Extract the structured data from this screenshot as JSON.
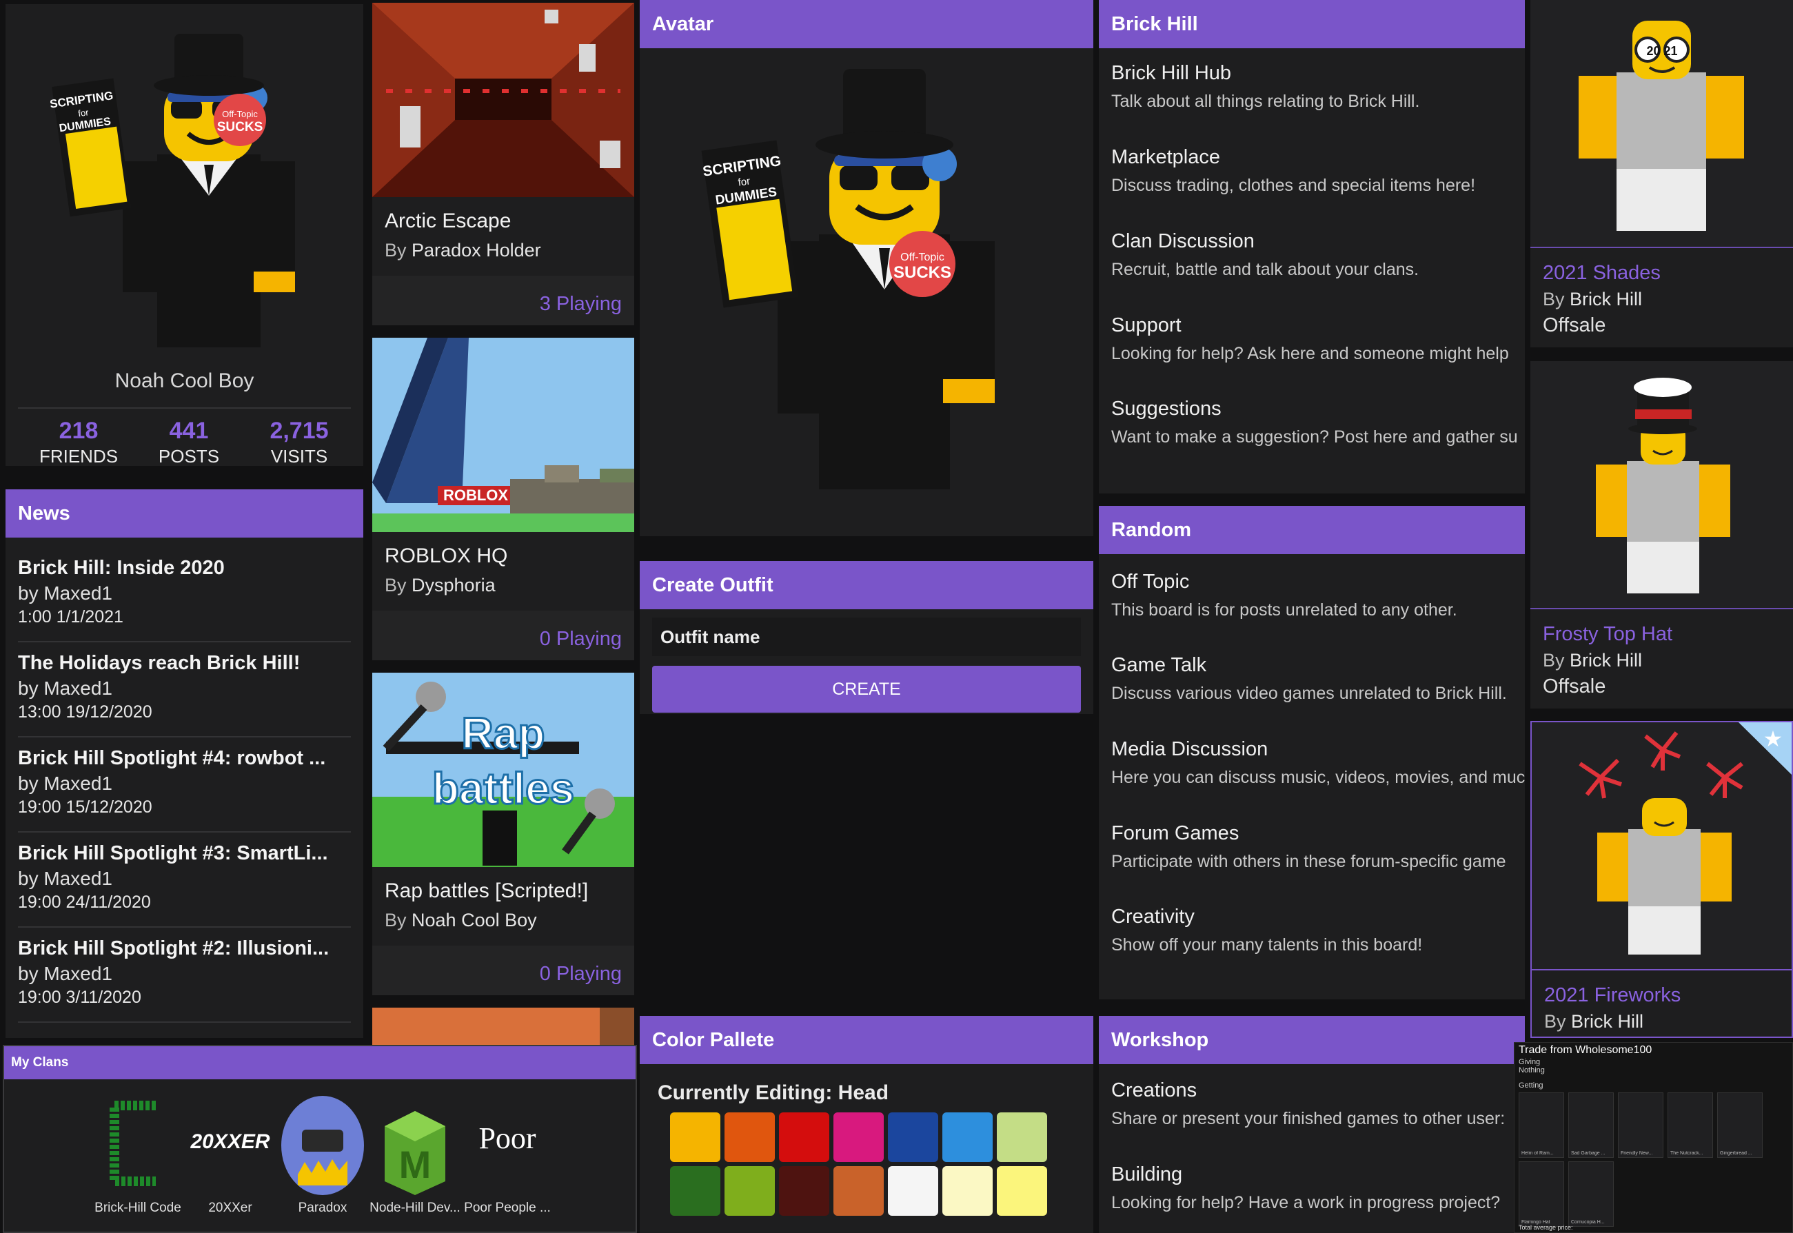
{
  "profile": {
    "username": "Noah Cool Boy",
    "stats": [
      {
        "value": "218",
        "label": "FRIENDS"
      },
      {
        "value": "441",
        "label": "POSTS"
      },
      {
        "value": "2,715",
        "label": "VISITS"
      }
    ]
  },
  "avatar_art": {
    "book_line1": "SCRIPTING",
    "book_line2": "for",
    "book_line3": "DUMMIES",
    "badge_line1": "Off-Topic",
    "badge_line2": "SUCKS"
  },
  "news": {
    "title": "News",
    "items": [
      {
        "title": "Brick Hill: Inside 2020",
        "author": "by Maxed1",
        "date": "1:00 1/1/2021"
      },
      {
        "title": "The Holidays reach Brick Hill!",
        "author": "by Maxed1",
        "date": "13:00 19/12/2020"
      },
      {
        "title": "Brick Hill Spotlight #4: rowbot ...",
        "author": "by Maxed1",
        "date": "19:00 15/12/2020"
      },
      {
        "title": "Brick Hill Spotlight #3: SmartLi...",
        "author": "by Maxed1",
        "date": "19:00 24/11/2020"
      },
      {
        "title": "Brick Hill Spotlight #2: Illusioni...",
        "author": "by Maxed1",
        "date": "19:00 3/11/2020"
      }
    ]
  },
  "games": [
    {
      "title": "Arctic Escape",
      "by": "By",
      "creator": "Paradox Holder",
      "playing": "3 Playing"
    },
    {
      "title": "ROBLOX HQ",
      "by": "By",
      "creator": "Dysphoria",
      "playing": "0 Playing",
      "thumb_text": "ROBLOX"
    },
    {
      "title": "Rap battles [Scripted!]",
      "by": "By",
      "creator": "Noah Cool Boy",
      "playing": "0 Playing",
      "thumb_text1": "Rap",
      "thumb_text2": "battles"
    }
  ],
  "avatar_panel": {
    "title": "Avatar"
  },
  "create_outfit": {
    "title": "Create Outfit",
    "input_placeholder": "Outfit name",
    "button": "CREATE"
  },
  "color_pallete": {
    "title": "Color Pallete",
    "editing": "Currently Editing: Head",
    "colors": [
      "#f5b400",
      "#e0560e",
      "#d40d0d",
      "#d8197e",
      "#1b469e",
      "#2d8fdd",
      "#c4dd86",
      "#2a6e1f",
      "#7fae1c",
      "#4e1310",
      "#c9622a",
      "#f5f5f5",
      "#fbf8c4",
      "#fbf57c"
    ]
  },
  "forums": [
    {
      "title": "Brick Hill",
      "boards": [
        {
          "name": "Brick Hill Hub",
          "desc": "Talk about all things relating to Brick Hill."
        },
        {
          "name": "Marketplace",
          "desc": "Discuss trading, clothes and special items here!"
        },
        {
          "name": "Clan Discussion",
          "desc": "Recruit, battle and talk about your clans."
        },
        {
          "name": "Support",
          "desc": "Looking for help? Ask here and someone might help"
        },
        {
          "name": "Suggestions",
          "desc": "Want to make a suggestion? Post here and gather su"
        }
      ]
    },
    {
      "title": "Random",
      "boards": [
        {
          "name": "Off Topic",
          "desc": "This board is for posts unrelated to any other."
        },
        {
          "name": "Game Talk",
          "desc": "Discuss various video games unrelated to Brick Hill."
        },
        {
          "name": "Media Discussion",
          "desc": "Here you can discuss music, videos, movies, and muc"
        },
        {
          "name": "Forum Games",
          "desc": "Participate with others in these forum-specific game"
        },
        {
          "name": "Creativity",
          "desc": "Show off your many talents in this board!"
        }
      ]
    },
    {
      "title": "Workshop",
      "boards": [
        {
          "name": "Creations",
          "desc": "Share or present your finished games to other user:"
        },
        {
          "name": "Building",
          "desc": "Looking for help? Have a work in progress project?"
        }
      ]
    }
  ],
  "shop": [
    {
      "name": "2021 Shades",
      "by": "By",
      "creator": "Brick Hill",
      "status": "Offsale",
      "shades_text": "20 21"
    },
    {
      "name": "Frosty Top Hat",
      "by": "By",
      "creator": "Brick Hill",
      "status": "Offsale"
    },
    {
      "name": "2021 Fireworks",
      "by": "By",
      "creator": "Brick Hill"
    }
  ],
  "clans": {
    "title": "My Clans",
    "items": [
      {
        "name": "Brick-Hill Code"
      },
      {
        "name": "20XXer",
        "logo_text": "20XXER"
      },
      {
        "name": "Paradox"
      },
      {
        "name": "Node-Hill Dev..."
      },
      {
        "name": "Poor People ...",
        "logo_text": "Poor"
      }
    ]
  },
  "trade": {
    "title": "Trade from Wholesome100",
    "giving": "Giving",
    "giving_items": "Nothing",
    "getting": "Getting",
    "items": [
      "Helm of Ram...",
      "Sad Garbage ...",
      "Friendly New...",
      "The Nutcrack...",
      "Gingerbread ...",
      "Flamingo Hat",
      "Cornucopia H..."
    ],
    "footer": "Total average price:"
  }
}
